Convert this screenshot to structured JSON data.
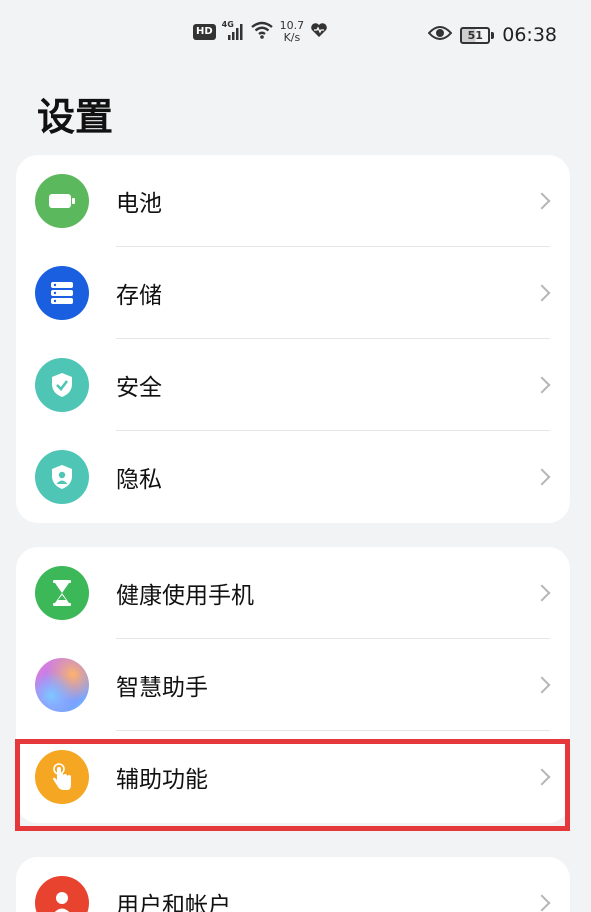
{
  "status_bar": {
    "hd_label": "HD",
    "network_type": "4G",
    "speed_value": "10.7",
    "speed_unit": "K/s",
    "battery_level": "51",
    "time": "06:38"
  },
  "page": {
    "title": "设置"
  },
  "groups": [
    {
      "items": [
        {
          "label": "电池",
          "icon": "battery-icon",
          "color": "#5cb85c"
        },
        {
          "label": "存储",
          "icon": "storage-icon",
          "color": "#1a5fe0"
        },
        {
          "label": "安全",
          "icon": "shield-check-icon",
          "color": "#4fc6b5"
        },
        {
          "label": "隐私",
          "icon": "privacy-shield-icon",
          "color": "#4fc6b5"
        }
      ]
    },
    {
      "items": [
        {
          "label": "健康使用手机",
          "icon": "hourglass-icon",
          "color": "#3cb858"
        },
        {
          "label": "智慧助手",
          "icon": "assistant-icon",
          "color": "gradient"
        },
        {
          "label": "辅助功能",
          "icon": "hand-touch-icon",
          "color": "#f5a623"
        }
      ]
    },
    {
      "items": [
        {
          "label": "用户和帐户",
          "icon": "user-icon",
          "color": "#e8432e"
        }
      ]
    }
  ]
}
